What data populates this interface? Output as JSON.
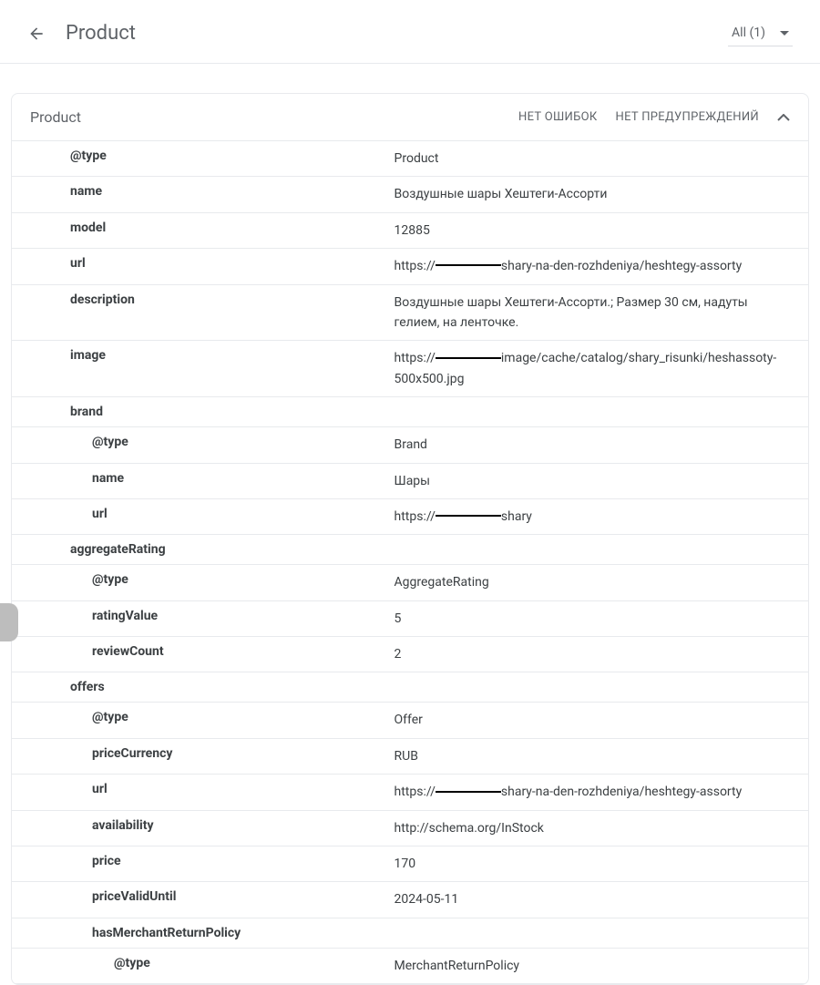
{
  "header": {
    "title": "Product",
    "filter_label": "All (1)"
  },
  "card": {
    "title": "Product",
    "status_errors": "НЕТ ОШИБОК",
    "status_warnings": "НЕТ ПРЕДУПРЕЖДЕНИЙ"
  },
  "rows": [
    {
      "key": "@type",
      "indent": 1,
      "value": "Product"
    },
    {
      "key": "name",
      "indent": 1,
      "value": "Воздушные шары Хештеги-Ассорти"
    },
    {
      "key": "model",
      "indent": 1,
      "value": "12885"
    },
    {
      "key": "url",
      "indent": 1,
      "parts": [
        "https://",
        "REDACT",
        "shary-na-den-rozhdeniya/heshtegy-assorty"
      ]
    },
    {
      "key": "description",
      "indent": 1,
      "value": "Воздушные шары Хештеги-Ассорти.; Размер 30 см, надуты гелием, на ленточке."
    },
    {
      "key": "image",
      "indent": 1,
      "parts": [
        "https://",
        "REDACT",
        "image/cache/catalog/shary_risunki/heshassoty-500x500.jpg"
      ]
    },
    {
      "key": "brand",
      "indent": 1,
      "value": ""
    },
    {
      "key": "@type",
      "indent": 2,
      "value": "Brand"
    },
    {
      "key": "name",
      "indent": 2,
      "value": "Шары"
    },
    {
      "key": "url",
      "indent": 2,
      "parts": [
        "https://",
        "REDACT",
        "shary"
      ]
    },
    {
      "key": "aggregateRating",
      "indent": 1,
      "value": ""
    },
    {
      "key": "@type",
      "indent": 2,
      "value": "AggregateRating"
    },
    {
      "key": "ratingValue",
      "indent": 2,
      "value": "5"
    },
    {
      "key": "reviewCount",
      "indent": 2,
      "value": "2"
    },
    {
      "key": "offers",
      "indent": 1,
      "value": ""
    },
    {
      "key": "@type",
      "indent": 2,
      "value": "Offer"
    },
    {
      "key": "priceCurrency",
      "indent": 2,
      "value": "RUB"
    },
    {
      "key": "url",
      "indent": 2,
      "parts": [
        "https://",
        "REDACT",
        "shary-na-den-rozhdeniya/heshtegy-assorty"
      ]
    },
    {
      "key": "availability",
      "indent": 2,
      "value": "http://schema.org/InStock"
    },
    {
      "key": "price",
      "indent": 2,
      "value": "170"
    },
    {
      "key": "priceValidUntil",
      "indent": 2,
      "value": "2024-05-11"
    },
    {
      "key": "hasMerchantReturnPolicy",
      "indent": 2,
      "value": ""
    },
    {
      "key": "@type",
      "indent": 3,
      "value": "MerchantReturnPolicy"
    }
  ],
  "indentPx": 24,
  "baseIndentPx": 40
}
